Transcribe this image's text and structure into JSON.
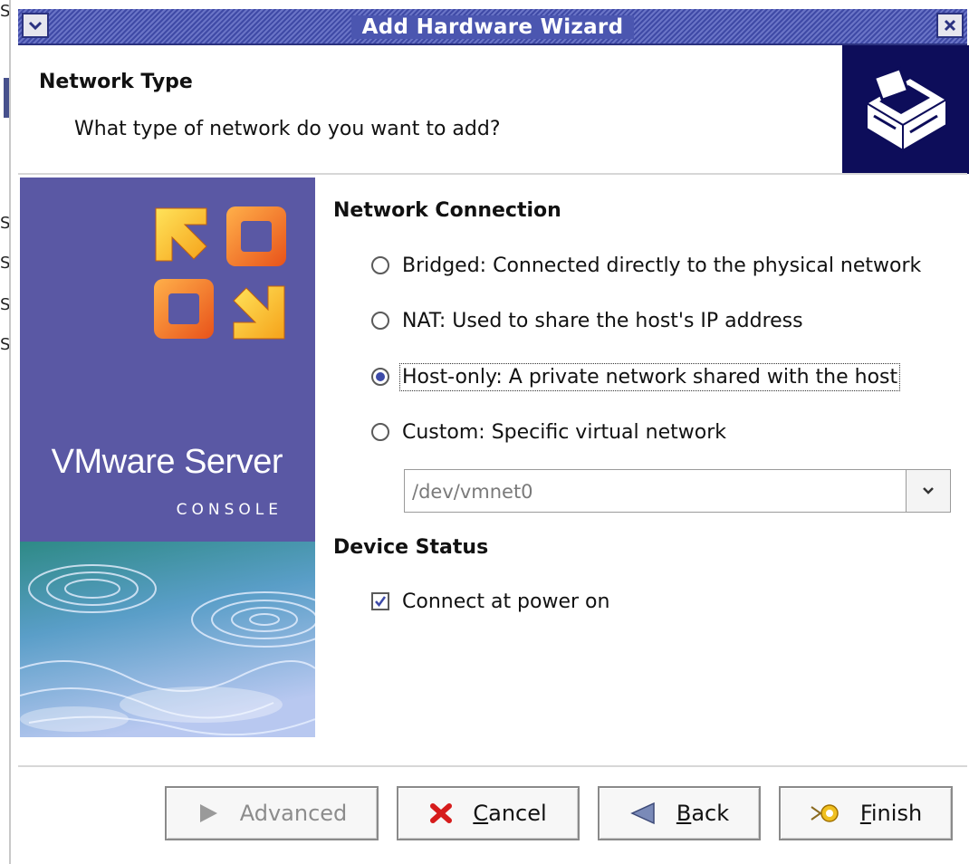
{
  "window": {
    "title": "Add Hardware Wizard"
  },
  "header": {
    "title": "Network Type",
    "subtitle": "What type of network do you want to add?"
  },
  "banner": {
    "brand": "VMware Server",
    "sub": "CONSOLE"
  },
  "network": {
    "section_title": "Network Connection",
    "options": [
      {
        "label": "Bridged: Connected directly to the physical network",
        "selected": false
      },
      {
        "label": "NAT: Used to share the host's IP address",
        "selected": false
      },
      {
        "label": "Host-only: A private network shared with the host",
        "selected": true
      },
      {
        "label": "Custom: Specific virtual network",
        "selected": false
      }
    ],
    "custom_network_value": "/dev/vmnet0"
  },
  "device_status": {
    "section_title": "Device Status",
    "connect_label": "Connect at power on",
    "connect_checked": true
  },
  "buttons": {
    "advanced": "Advanced",
    "cancel_mnemonic": "C",
    "cancel_rest": "ancel",
    "back_mnemonic": "B",
    "back_rest": "ack",
    "finish_mnemonic": "F",
    "finish_rest": "inish"
  },
  "background_window": {
    "glyphs": [
      "S",
      "S",
      "S",
      "S",
      "S"
    ]
  },
  "colors": {
    "titlebar": "#3f4aa6",
    "banner": "#5a58a4",
    "header_icon_bg": "#0d0d5a",
    "radio_selected": "#3d4aa8"
  }
}
